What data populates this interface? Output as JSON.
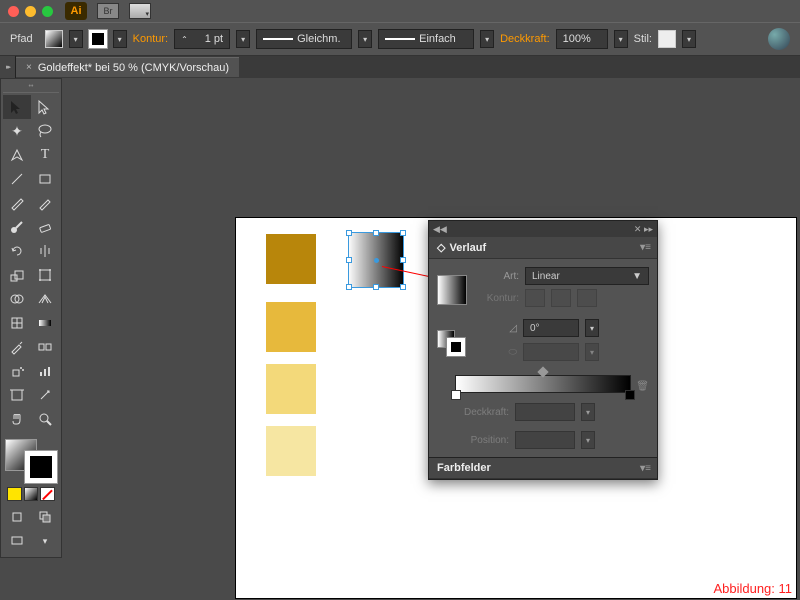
{
  "titlebar": {
    "app_badge": "Ai"
  },
  "control": {
    "selection_label": "Pfad",
    "stroke_label": "Kontur:",
    "stroke_weight": "1 pt",
    "cap_label": "Gleichm.",
    "profile_label": "Einfach",
    "opacity_label": "Deckkraft:",
    "opacity_value": "100%",
    "style_label": "Stil:"
  },
  "doc": {
    "tab_title": "Goldeffekt* bei 50 % (CMYK/Vorschau)"
  },
  "swatches": [
    {
      "color": "#b8860b"
    },
    {
      "color": "#e7b93c"
    },
    {
      "color": "#f3d97a"
    },
    {
      "color": "#f6e6a2"
    }
  ],
  "panel": {
    "title": "Verlauf",
    "type_label": "Art:",
    "type_value": "Linear",
    "stroke_label": "Kontur:",
    "angle_value": "0°",
    "opacity_label": "Deckkraft:",
    "position_label": "Position:",
    "footer_title": "Farbfelder"
  },
  "caption": "Abbildung: 11"
}
